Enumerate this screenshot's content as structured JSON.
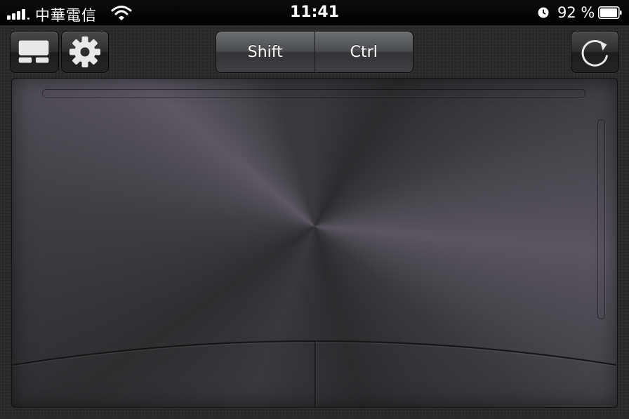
{
  "status_bar": {
    "carrier": "中華電信",
    "time": "11:41",
    "battery": "92 %",
    "icons": [
      "signal-bars-icon",
      "wifi-icon",
      "alarm-clock-icon",
      "battery-icon"
    ]
  },
  "toolbar": {
    "keyboard_icon": "keyboard-icon",
    "settings_icon": "gear-icon",
    "rotate_icon": "refresh-icon",
    "modifiers": [
      {
        "label": "Shift"
      },
      {
        "label": "Ctrl"
      }
    ]
  },
  "colors": {
    "background": "#2a2a2b",
    "status_bar": "#000000",
    "button_text": "#ffffff"
  }
}
